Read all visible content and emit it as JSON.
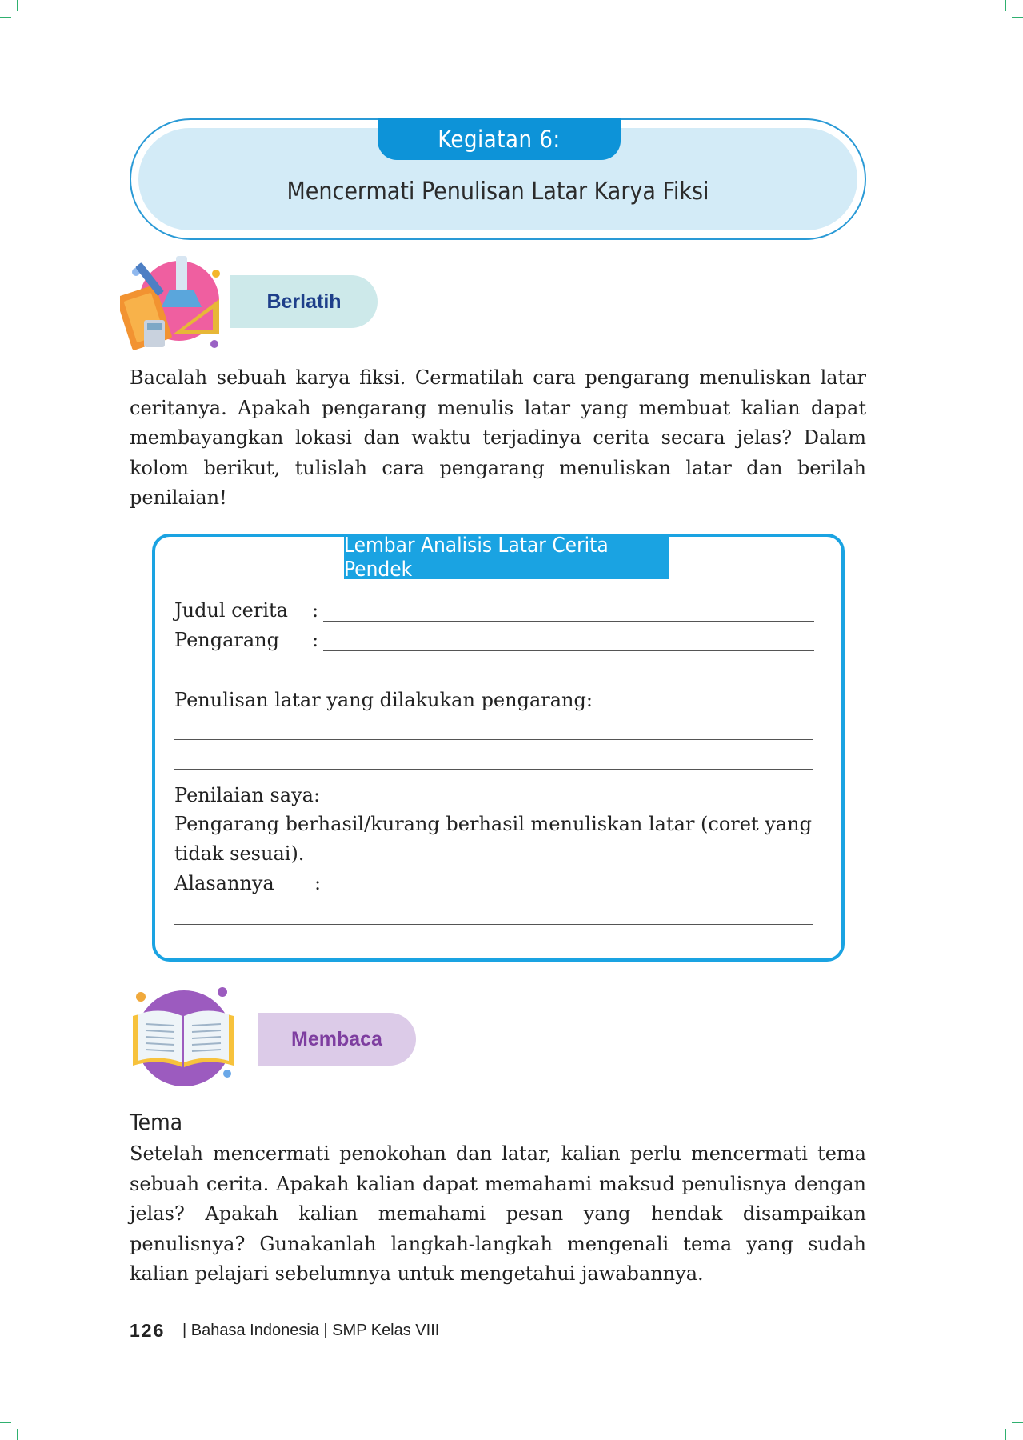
{
  "activity": {
    "title": "Kegiatan 6:",
    "subtitle": "Mencermati Penulisan Latar Karya Fiksi"
  },
  "sections": {
    "practice_label": "Berlatih",
    "reading_label": "Membaca"
  },
  "practice": {
    "instruction": "Bacalah sebuah karya fiksi. Cermatilah cara pengarang menuliskan latar ceritanya. Apakah pengarang menulis latar yang membuat kalian dapat membayangkan lokasi dan waktu terjadinya cerita secara jelas? Dalam kolom berikut, tulislah cara pengarang menuliskan latar dan berilah penilaian!"
  },
  "worksheet": {
    "title": "Lembar Analisis Latar Cerita Pendek",
    "story_title_label": "Judul cerita",
    "author_label": "Pengarang",
    "colon": ":",
    "setting_prompt": "Penulisan latar yang dilakukan pengarang:",
    "assessment_label": "Penilaian saya:",
    "assessment_line_1": "Pengarang berhasil/kurang berhasil menuliskan latar (coret yang",
    "assessment_line_2": "tidak sesuai).",
    "reason_label": "Alasannya"
  },
  "reading": {
    "heading": "Tema",
    "body": "Setelah mencermati penokohan dan latar, kalian perlu mencermati tema sebuah cerita. Apakah kalian dapat memahami maksud penulisnya dengan jelas? Apakah kalian memahami pesan yang hendak disampaikan penulisnya? Gunakanlah langkah-langkah mengenali tema yang sudah kalian pelajari sebelumnya untuk mengetahui jawabannya."
  },
  "footer": {
    "page_number": "126",
    "book_info": "| Bahasa Indonesia | SMP Kelas VIII"
  },
  "colors": {
    "accent_blue": "#0d93d8",
    "header_fill": "#d3ebf7",
    "practice_pill": "#cde9ea",
    "reading_pill": "#dccbe8",
    "crop_mark": "#2fb06f"
  }
}
